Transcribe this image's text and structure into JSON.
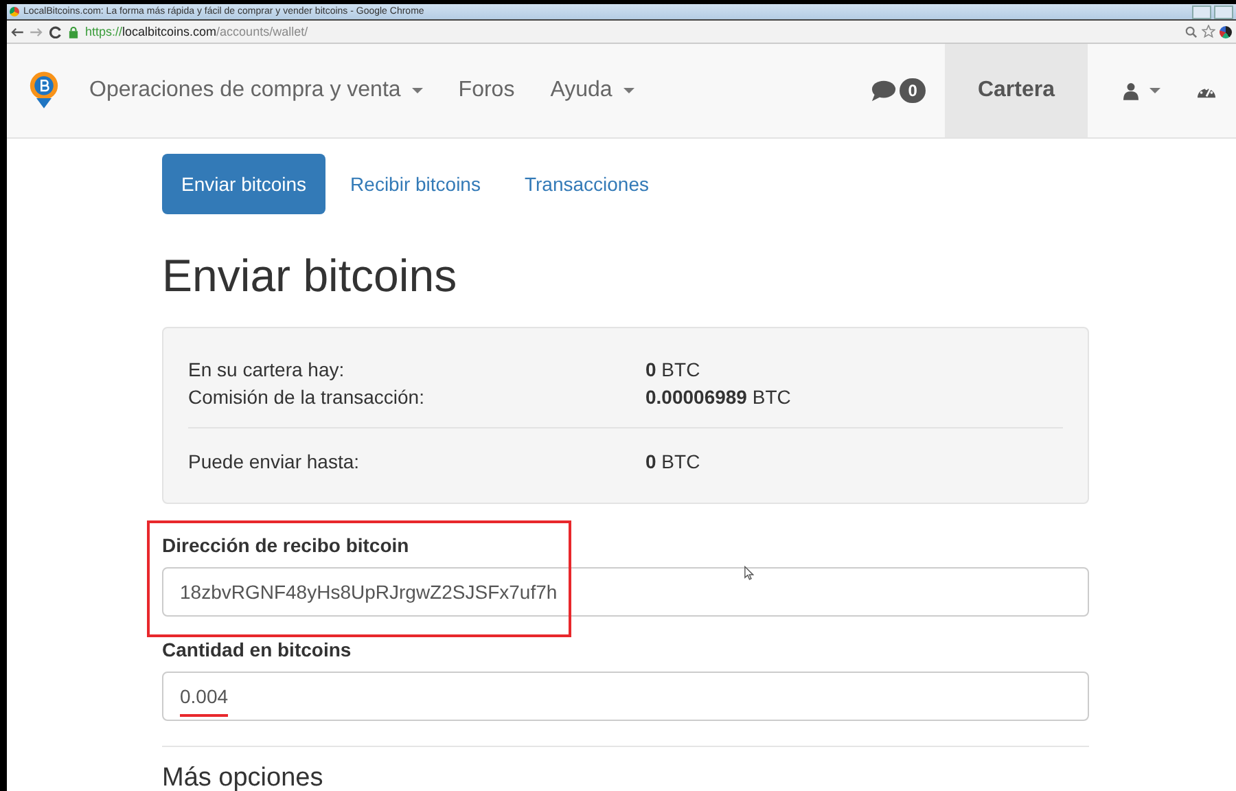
{
  "window": {
    "title": "LocalBitcoins.com: La forma más rápida y fácil de comprar y vender bitcoins - Google Chrome"
  },
  "address_bar": {
    "scheme": "https://",
    "domain": "localbitcoins.com",
    "path": "/accounts/wallet/"
  },
  "navbar": {
    "items": [
      {
        "label": "Operaciones de compra y venta",
        "dropdown": true
      },
      {
        "label": "Foros",
        "dropdown": false
      },
      {
        "label": "Ayuda",
        "dropdown": true
      }
    ],
    "messages_count": "0",
    "right_items": [
      {
        "label": "Cartera",
        "selected": true
      }
    ]
  },
  "tabs": [
    {
      "label": "Enviar bitcoins",
      "selected": true
    },
    {
      "label": "Recibir bitcoins",
      "selected": false
    },
    {
      "label": "Transacciones",
      "selected": false
    }
  ],
  "heading": "Enviar bitcoins",
  "summary": {
    "groups": [
      [
        {
          "label": "En su cartera hay:",
          "amount": "0",
          "unit": "BTC"
        },
        {
          "label": "Comisión de la transacción:",
          "amount": "0.00006989",
          "unit": "BTC"
        }
      ],
      [
        {
          "label": "Puede enviar hasta:",
          "amount": "0",
          "unit": "BTC"
        }
      ]
    ]
  },
  "fields": [
    {
      "label": "Dirección de recibo bitcoin",
      "value": "18zbvRGNF48yHs8UpRJrgwZ2SJSFx7uf7h",
      "boxed": true,
      "underlined": false
    },
    {
      "label": "Cantidad en bitcoins",
      "value": "0.004",
      "boxed": false,
      "underlined": true
    }
  ],
  "section": "Más opciones"
}
